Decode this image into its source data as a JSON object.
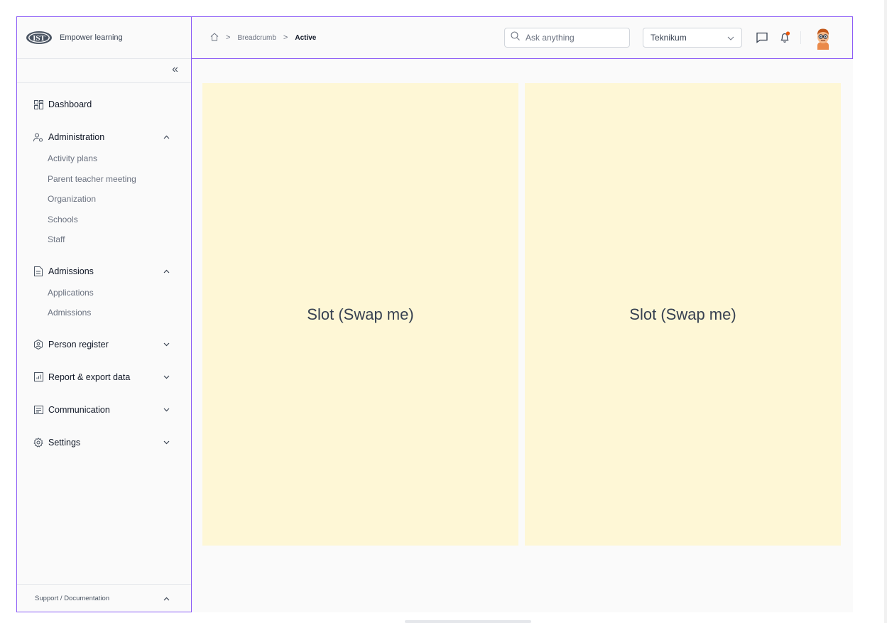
{
  "sidebar": {
    "logo_text": "IST",
    "brand": "Empower learning",
    "collapse_icon": "chevrons-left-icon",
    "items": [
      {
        "label": "Dashboard",
        "icon": "dashboard-grid-icon"
      },
      {
        "label": "Administration",
        "icon": "users-admin-icon",
        "expanded": true,
        "children": [
          "Activity plans",
          "Parent teacher meeting",
          "Organization",
          "Schools",
          "Staff"
        ]
      },
      {
        "label": "Admissions",
        "icon": "document-icon",
        "expanded": true,
        "children": [
          "Applications",
          "Admissions"
        ]
      },
      {
        "label": "Person register",
        "icon": "person-badge-icon",
        "expanded": false
      },
      {
        "label": "Report & export data",
        "icon": "report-chart-icon",
        "expanded": false
      },
      {
        "label": "Communication",
        "icon": "message-list-icon",
        "expanded": false
      },
      {
        "label": "Settings",
        "icon": "gear-icon",
        "expanded": false
      }
    ],
    "footer": {
      "label": "Support / Documentation",
      "expanded": true
    }
  },
  "header": {
    "breadcrumb": {
      "home_icon": "home-icon",
      "items": [
        "Breadcrumb",
        "Active"
      ]
    },
    "search": {
      "placeholder": "Ask anything",
      "value": ""
    },
    "school_select": {
      "value": "Teknikum"
    },
    "icons": [
      "chat-icon",
      "bell-icon",
      "avatar"
    ],
    "notification_color": "#ea580c"
  },
  "main": {
    "slots": [
      {
        "label": "Slot (Swap me)"
      },
      {
        "label": "Slot (Swap me)"
      }
    ],
    "slot_color": "#fef7d6"
  },
  "colors": {
    "accent": "#8b5cf6",
    "background": "#fafafa"
  }
}
